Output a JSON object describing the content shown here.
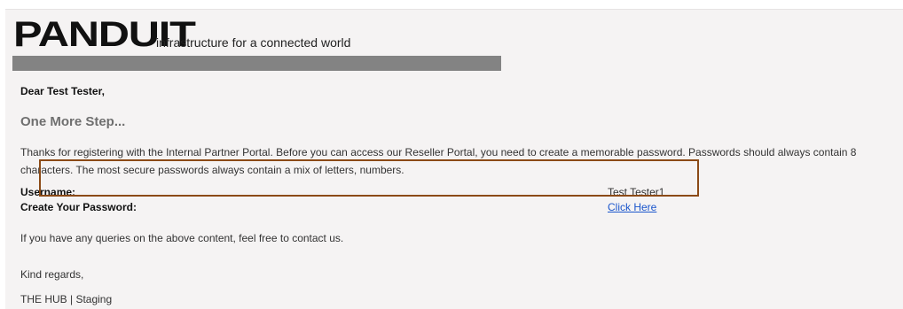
{
  "branding": {
    "logo_text": "PANDUIT",
    "tagline": "infrastructure for a connected world"
  },
  "email": {
    "greeting": "Dear Test Tester,",
    "heading": "One More Step...",
    "body": "Thanks for registering with the Internal Partner Portal. Before you can access our Reseller Portal, you need to create a memorable password. Passwords should always contain 8 characters. The most secure passwords always contain a mix of letters, numbers.",
    "username_label": "Username:",
    "username_value": "Test Tester1",
    "password_label": "Create Your Password:",
    "password_link": "Click Here",
    "queries": "If you have any queries on the above content, feel free to contact us.",
    "closing": "Kind regards,",
    "signature": "THE HUB | Staging"
  },
  "colors": {
    "background": "#f5f3f3",
    "banner_bar": "#838383",
    "heading_gray": "#6f6f6f",
    "link_blue": "#1a55cc",
    "highlight_border": "#8b4a16"
  }
}
